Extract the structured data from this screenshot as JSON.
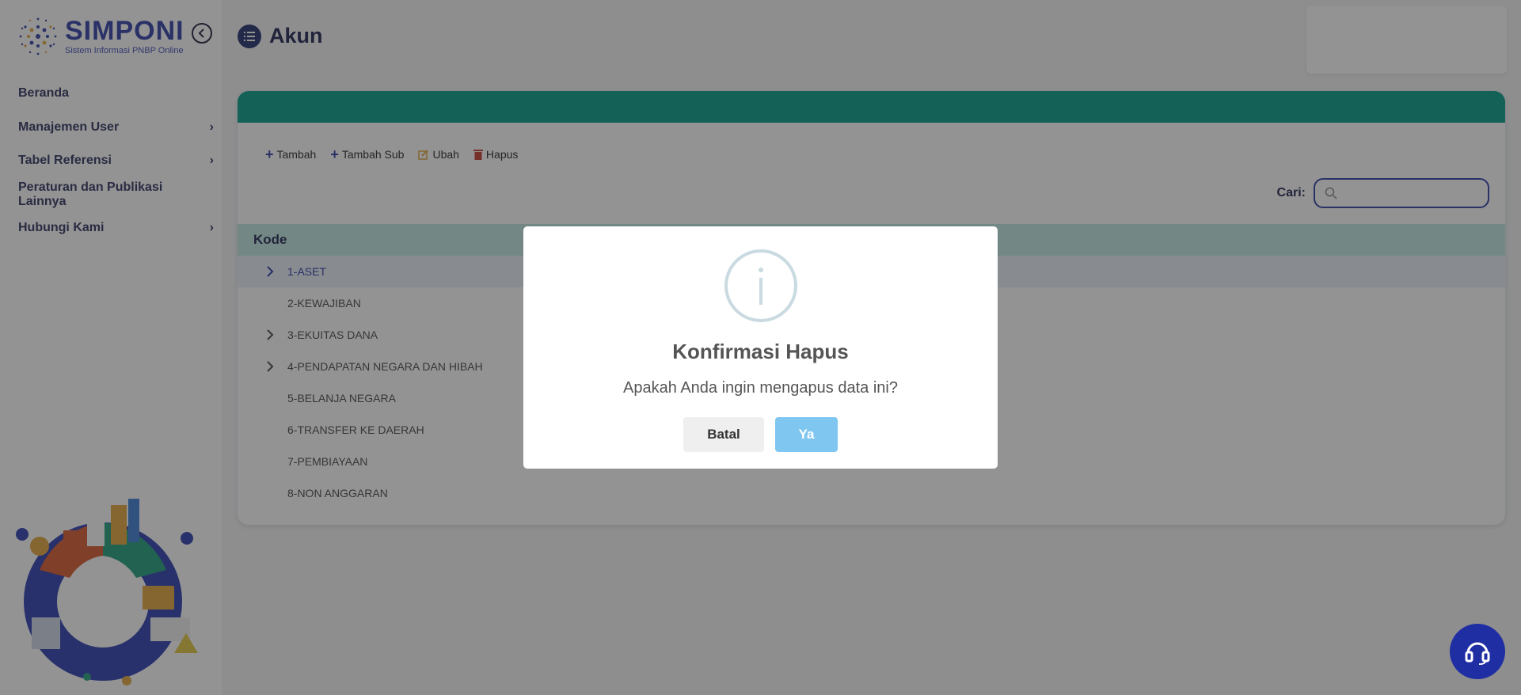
{
  "app": {
    "logo_title": "SIMPONI",
    "logo_subtitle": "Sistem Informasi PNBP Online",
    "brand_color": "#2b3aa6"
  },
  "sidebar": {
    "items": [
      {
        "label": "Beranda",
        "has_children": false
      },
      {
        "label": "Manajemen User",
        "has_children": true
      },
      {
        "label": "Tabel Referensi",
        "has_children": true
      },
      {
        "label": "Peraturan dan Publikasi Lainnya",
        "has_children": false
      },
      {
        "label": "Hubungi Kami",
        "has_children": true
      }
    ]
  },
  "page": {
    "title": "Akun",
    "header_color": "#009b86"
  },
  "toolbar": {
    "add_label": "Tambah",
    "add_sub_label": "Tambah Sub",
    "edit_label": "Ubah",
    "delete_label": "Hapus"
  },
  "search": {
    "label": "Cari:",
    "placeholder": ""
  },
  "table": {
    "header": "Kode",
    "rows": [
      {
        "label": "1-ASET",
        "expandable": true,
        "selected": true
      },
      {
        "label": "2-KEWAJIBAN",
        "expandable": false,
        "selected": false
      },
      {
        "label": "3-EKUITAS DANA",
        "expandable": true,
        "selected": false
      },
      {
        "label": "4-PENDAPATAN NEGARA DAN HIBAH",
        "expandable": true,
        "selected": false
      },
      {
        "label": "5-BELANJA NEGARA",
        "expandable": false,
        "selected": false
      },
      {
        "label": "6-TRANSFER KE DAERAH",
        "expandable": false,
        "selected": false
      },
      {
        "label": "7-PEMBIAYAAN",
        "expandable": false,
        "selected": false
      },
      {
        "label": "8-NON ANGGARAN",
        "expandable": false,
        "selected": false
      }
    ]
  },
  "modal": {
    "icon": "info-icon",
    "title": "Konfirmasi Hapus",
    "text": "Apakah Anda ingin mengapus data ini?",
    "cancel_label": "Batal",
    "confirm_label": "Ya"
  }
}
